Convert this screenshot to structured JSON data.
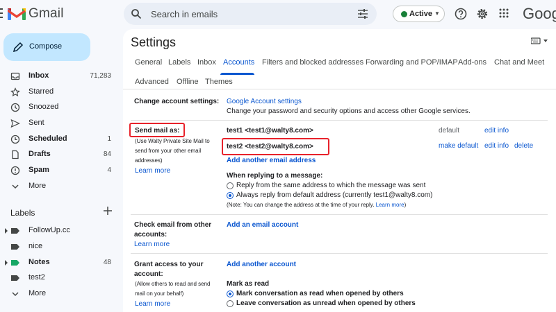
{
  "app": {
    "name": "Gmail",
    "google_text": "Google"
  },
  "search": {
    "placeholder": "Search in emails"
  },
  "status": {
    "label": "Active",
    "color": "#188038"
  },
  "compose": {
    "label": "Compose"
  },
  "nav": [
    {
      "label": "Inbox",
      "count": "71,283",
      "icon": "inbox-icon",
      "bold": true
    },
    {
      "label": "Starred",
      "count": "",
      "icon": "star-icon",
      "bold": false
    },
    {
      "label": "Snoozed",
      "count": "",
      "icon": "clock-icon",
      "bold": false
    },
    {
      "label": "Sent",
      "count": "",
      "icon": "send-icon",
      "bold": false
    },
    {
      "label": "Scheduled",
      "count": "1",
      "icon": "scheduled-icon",
      "bold": true
    },
    {
      "label": "Drafts",
      "count": "84",
      "icon": "draft-icon",
      "bold": true
    },
    {
      "label": "Spam",
      "count": "4",
      "icon": "spam-icon",
      "bold": true
    },
    {
      "label": "More",
      "count": "",
      "icon": "chevron-down-icon",
      "bold": false
    }
  ],
  "labels_section": {
    "title": "Labels",
    "items": [
      {
        "label": "FollowUp.cc",
        "count": "",
        "color": "#444746",
        "bold": false
      },
      {
        "label": "nice",
        "count": "",
        "color": "#444746",
        "bold": false
      },
      {
        "label": "Notes",
        "count": "48",
        "color": "#16a765",
        "bold": true
      },
      {
        "label": "test2",
        "count": "",
        "color": "#444746",
        "bold": false
      },
      {
        "label": "More",
        "count": "",
        "color": "",
        "bold": false
      }
    ]
  },
  "settings": {
    "title": "Settings",
    "tabs_row1": [
      "General",
      "Labels",
      "Inbox",
      "Accounts",
      "Filters and blocked addresses",
      "Forwarding and POP/IMAP",
      "Add-ons",
      "Chat and Meet"
    ],
    "tabs_row2": [
      "Advanced",
      "Offline",
      "Themes"
    ],
    "active_tab": "Accounts",
    "change_account": {
      "label": "Change account settings:",
      "link": "Google Account settings",
      "desc": "Change your password and security options and access other Google services."
    },
    "send_mail": {
      "label": "Send mail as:",
      "note_lines": [
        "(Use Walty Private Site Mail to",
        "send from your other email",
        "addresses)"
      ],
      "learn_more": "Learn more",
      "addresses": [
        {
          "address": "test1 <test1@walty8.com>",
          "status": "default",
          "actions": [
            "edit info"
          ]
        },
        {
          "address": "test2 <test2@walty8.com>",
          "status": "",
          "actions": [
            "make default",
            "edit info",
            "delete"
          ]
        }
      ],
      "add_link": "Add another email address",
      "replying_title": "When replying to a message:",
      "reply_same": "Reply from the same address to which the message was sent",
      "reply_default": "Always reply from default address (currently test1@walty8.com)",
      "reply_selected": "default",
      "reply_note": "(Note: You can change the address at the time of your reply. ",
      "reply_note_link": "Learn more",
      "reply_note_end": ")"
    },
    "check_mail": {
      "label_lines": [
        "Check email from other",
        "accounts:"
      ],
      "learn_more": "Learn more",
      "link": "Add an email account"
    },
    "grant_access": {
      "label_lines": [
        "Grant access to your",
        "account:"
      ],
      "note_lines": [
        "(Allow others to read and send",
        "mail on your behalf)"
      ],
      "learn_more": "Learn more",
      "link": "Add another account",
      "mark_title": "Mark as read",
      "mark_read": "Mark conversation as read when opened by others",
      "leave_unread": "Leave conversation as unread when opened by others",
      "mark_selected": "read"
    }
  },
  "colors": {
    "accent": "#0b57d0",
    "highlight_box": "#e8222b",
    "compose_bg": "#c2e7ff"
  }
}
